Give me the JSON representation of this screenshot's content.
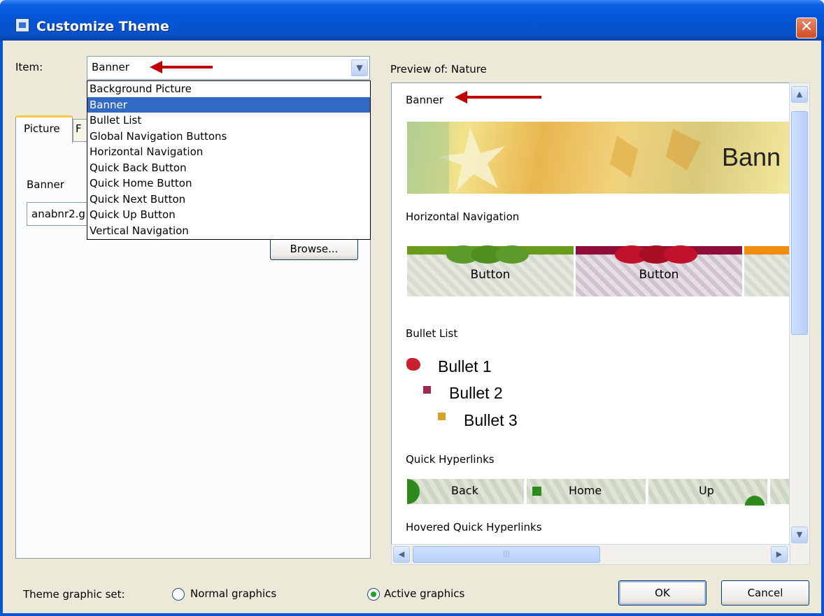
{
  "window": {
    "title": "Customize Theme",
    "close_label": "✕"
  },
  "item": {
    "label": "Item:",
    "selected": "Banner",
    "options": [
      "Background Picture",
      "Banner",
      "Bullet List",
      "Global Navigation Buttons",
      "Horizontal Navigation",
      "Quick Back Button",
      "Quick Home Button",
      "Quick Next Button",
      "Quick Up Button",
      "Vertical Navigation"
    ],
    "selected_index": 1
  },
  "tabs": {
    "picture": "Picture",
    "font": "F"
  },
  "picture_tab": {
    "banner_label": "Banner",
    "file_value": "anabnr2.g",
    "browse_label": "Browse..."
  },
  "preview": {
    "title": "Preview of: Nature",
    "banner_heading": "Banner",
    "banner_text": "Bann",
    "hnav_heading": "Horizontal Navigation",
    "nav_buttons": [
      "Button",
      "Button"
    ],
    "bullet_heading": "Bullet List",
    "bullets": [
      "Bullet 1",
      "Bullet 2",
      "Bullet 3"
    ],
    "quick_heading": "Quick Hyperlinks",
    "quick_links": [
      "Back",
      "Home",
      "Up"
    ],
    "hovered_heading": "Hovered Quick Hyperlinks"
  },
  "graphic_set": {
    "label": "Theme graphic set:",
    "normal": "Normal graphics",
    "active": "Active graphics",
    "selected": "active"
  },
  "buttons": {
    "ok": "OK",
    "cancel": "Cancel"
  },
  "colors": {
    "title_bar": "#0454d6",
    "selection": "#316ac5",
    "annotation_arrow": "#c00000"
  }
}
